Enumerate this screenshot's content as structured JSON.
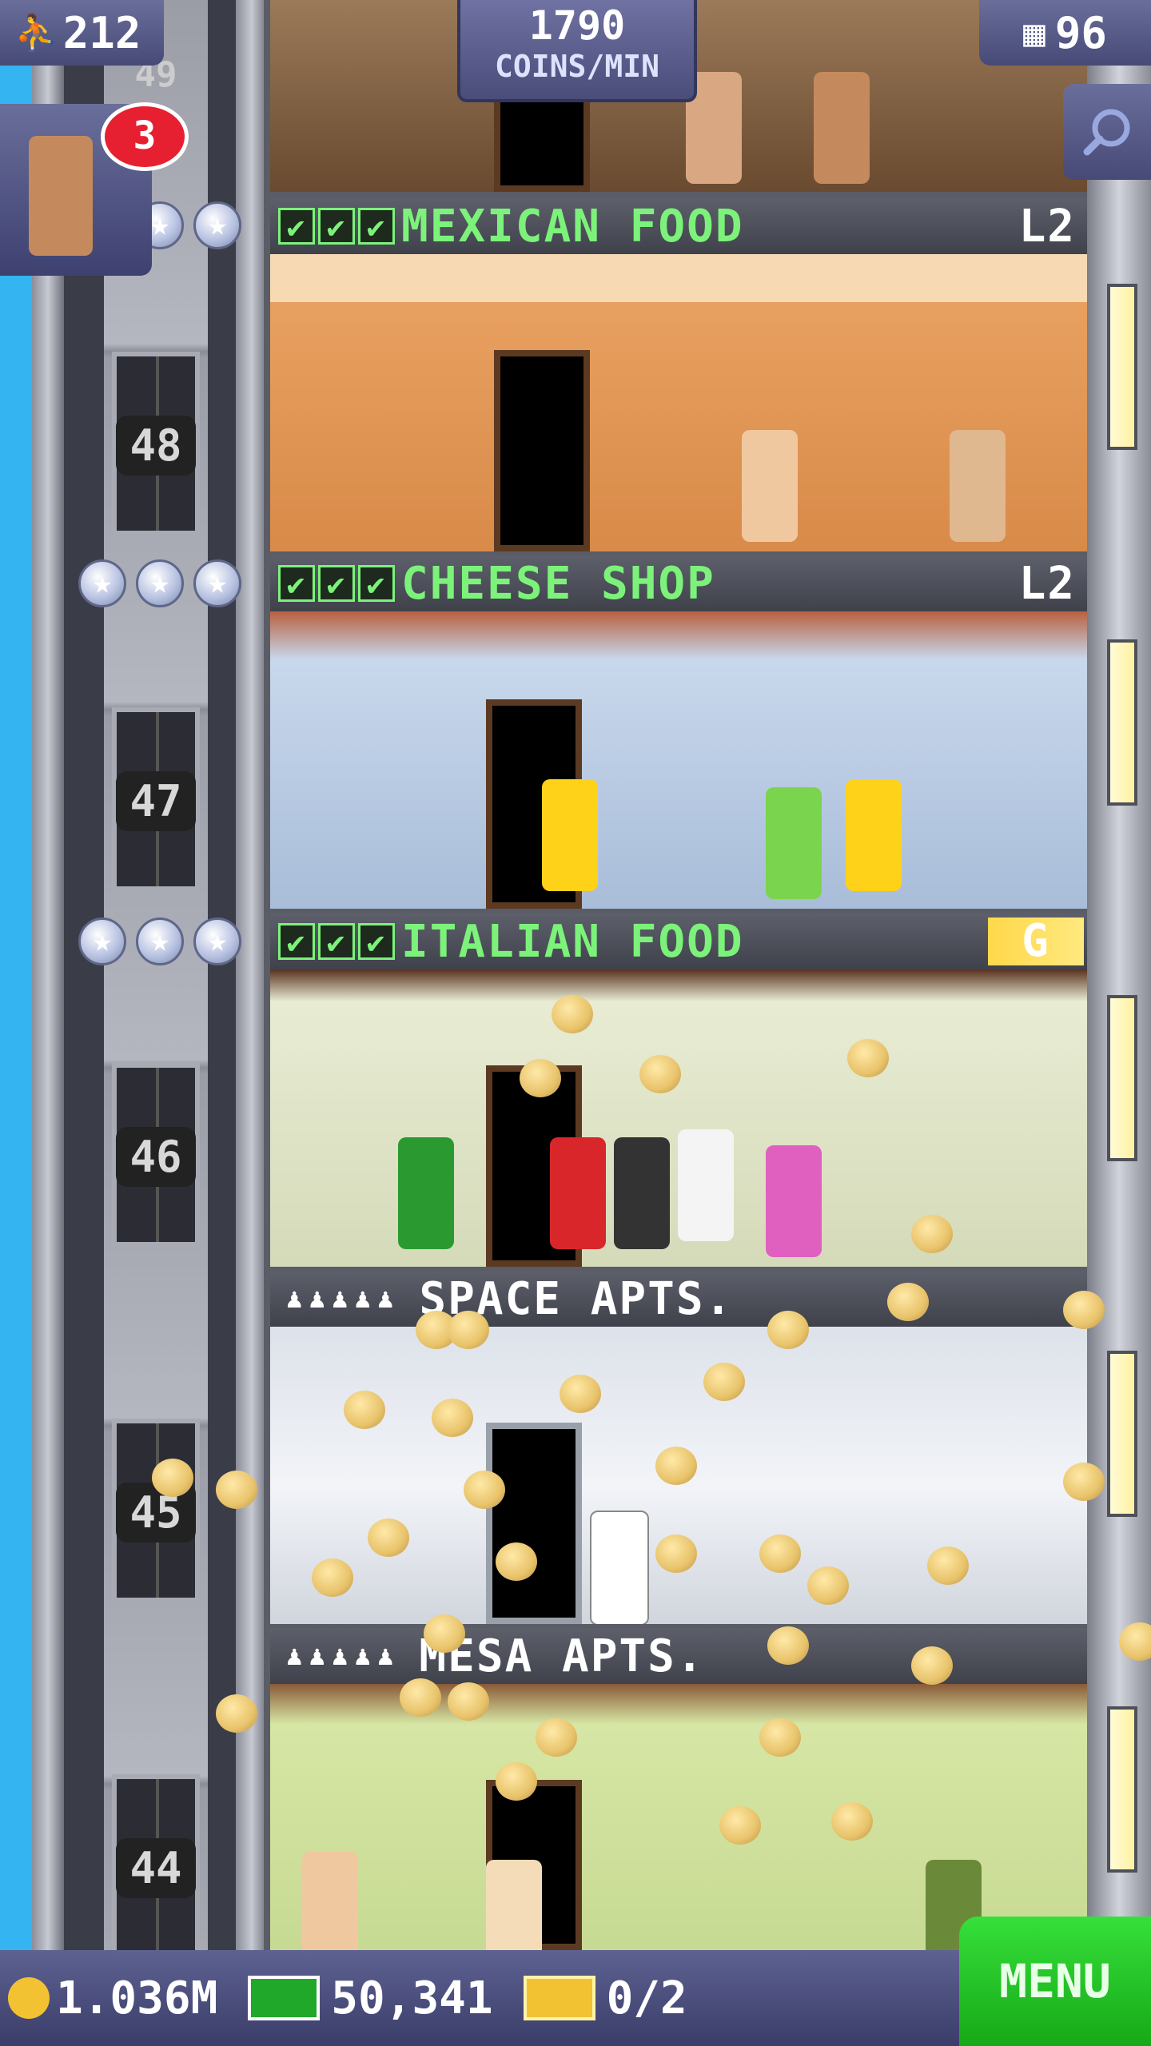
{
  "header": {
    "population": "212",
    "coins_per_min_value": "1790",
    "coins_per_min_label": "COINS/MIN",
    "floor_count": "96"
  },
  "notifications": {
    "badge_count": "3"
  },
  "elevator": {
    "floors": [
      "49",
      "48",
      "47",
      "46",
      "45",
      "44"
    ]
  },
  "floors": [
    {
      "name": "MEXICAN FOOD",
      "level": "L2",
      "checks": 3
    },
    {
      "name": "CHEESE SHOP",
      "level": "L2",
      "checks": 3
    },
    {
      "name": "ITALIAN FOOD",
      "badge": "G",
      "checks": 3
    },
    {
      "name": "SPACE APTS.",
      "residents": 5
    },
    {
      "name": "MESA APTS.",
      "residents": 5
    }
  ],
  "bottom_bar": {
    "coins": "1.036M",
    "bux": "50,341",
    "tickets": "0/2",
    "menu_label": "MENU"
  },
  "colors": {
    "label_green": "#7cf27a",
    "menu_green": "#22c024",
    "bar_purple": "#4a4d7a",
    "sky": "#34b4f0",
    "coin_gold": "#e8c36a"
  }
}
